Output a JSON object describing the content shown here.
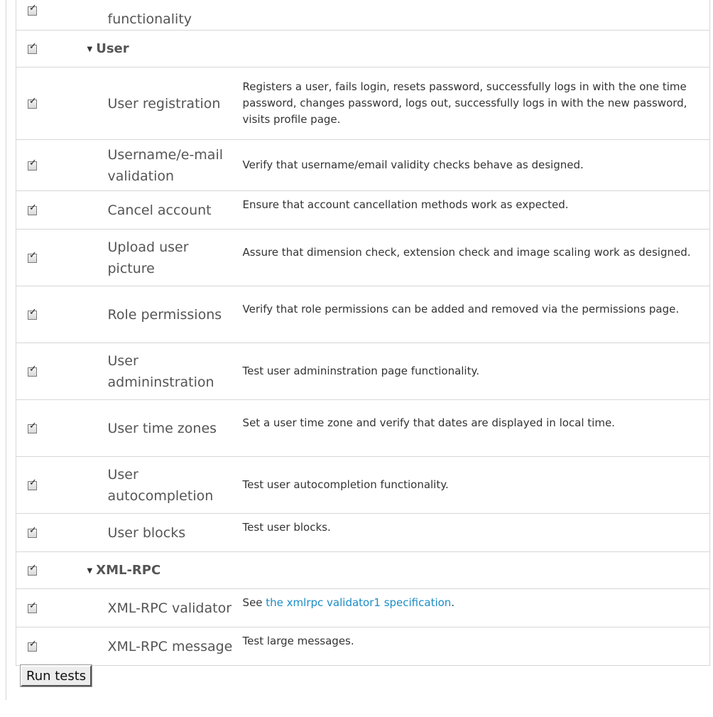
{
  "groups": [
    {
      "title": "",
      "tests": [
        {
          "name": "functionality",
          "description": ""
        }
      ]
    },
    {
      "title": "User",
      "tests": [
        {
          "name": "User registration",
          "description": "Registers a user, fails login, resets password, successfully logs in with the one time password, changes password, logs out, successfully logs in with the new password, visits profile page."
        },
        {
          "name": "Username/e-mail validation",
          "description": "Verify that username/email validity checks behave as designed."
        },
        {
          "name": "Cancel account",
          "description": "Ensure that account cancellation methods work as expected."
        },
        {
          "name": "Upload user picture",
          "description": "Assure that dimension check, extension check and image scaling work as designed."
        },
        {
          "name": "Role permissions",
          "description": "Verify that role permissions can be added and removed via the permissions page."
        },
        {
          "name": "User admininstration",
          "description": "Test user admininstration page functionality."
        },
        {
          "name": "User time zones",
          "description": "Set a user time zone and verify that dates are displayed in local time."
        },
        {
          "name": "User autocompletion",
          "description": "Test user autocompletion functionality."
        },
        {
          "name": "User blocks",
          "description": "Test user blocks."
        }
      ]
    },
    {
      "title": "XML-RPC",
      "tests": [
        {
          "name": "XML-RPC validator",
          "description_prefix": "See ",
          "description_link": "the xmlrpc validator1 specification",
          "description_suffix": "."
        },
        {
          "name": "XML-RPC message",
          "description": "Test large messages."
        }
      ]
    }
  ],
  "actions": {
    "run_label": "Run tests"
  },
  "icons": {
    "checkbox": "checked-checkbox-icon",
    "caret": "caret-down-icon"
  },
  "colors": {
    "link": "#1a8cc6",
    "border": "#d7d7d7",
    "text": "#555555"
  }
}
